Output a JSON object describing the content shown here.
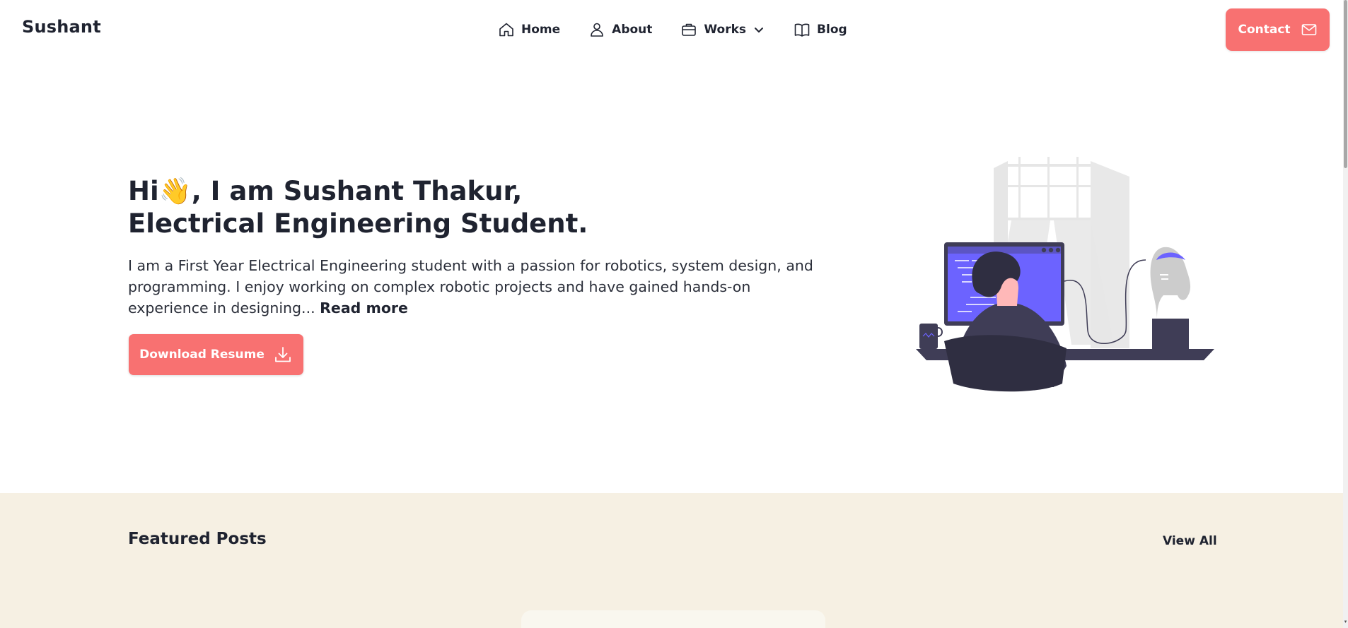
{
  "brand": "Sushant",
  "nav": {
    "home": "Home",
    "about": "About",
    "works": "Works",
    "blog": "Blog",
    "contact": "Contact"
  },
  "hero": {
    "title_pre": "Hi",
    "wave": "👋",
    "title_line1_rest": ", I am Sushant Thakur,",
    "title_line2": "Electrical Engineering Student.",
    "description": "I am a First Year Electrical Engineering student with a passion for robotics, system design, and programming. I enjoy working on complex robotic projects and have gained hands-on experience in designing...",
    "read_more": "Read more",
    "resume_button": "Download Resume"
  },
  "featured": {
    "title": "Featured Posts",
    "view_all": "View All"
  },
  "icons": {
    "home": "home-icon",
    "about": "user-icon",
    "works": "briefcase-icon",
    "works_toggle": "chevron-down-icon",
    "blog": "book-icon",
    "contact": "mail-icon",
    "resume": "download-icon"
  },
  "colors": {
    "accent": "#f87171",
    "text": "#1f2330",
    "featured_bg": "#f6f0e3",
    "illustration_purple": "#6c63ff",
    "illustration_dark": "#3f3d56"
  }
}
